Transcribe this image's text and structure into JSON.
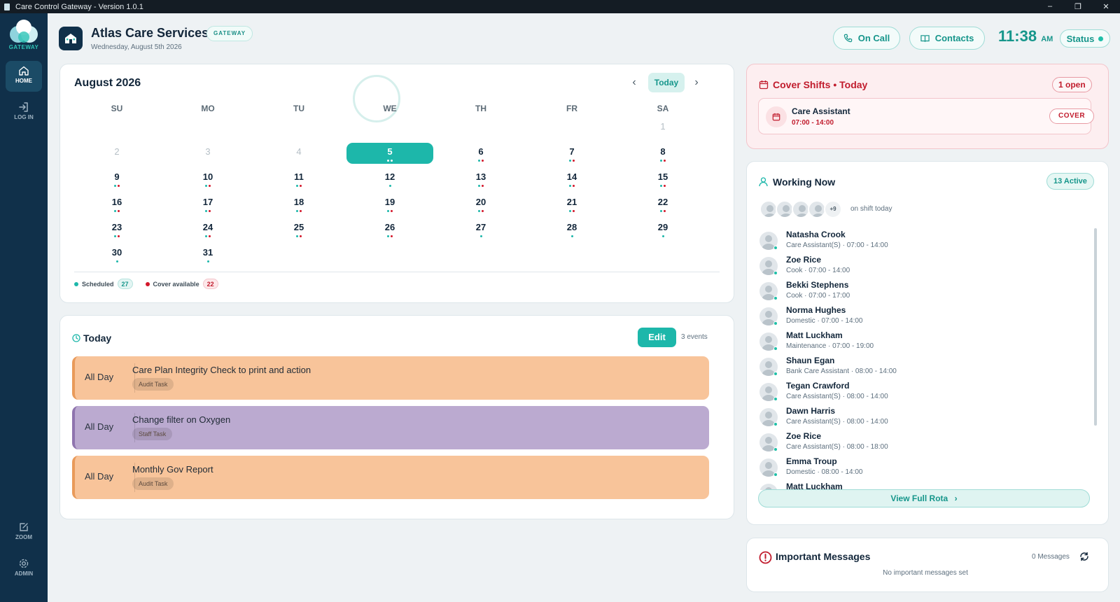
{
  "window": {
    "title": "Care Control Gateway - Version 1.0.1",
    "controls": [
      "–",
      "❐",
      "✕"
    ]
  },
  "sidebar": {
    "logo_text": "GATEWAY",
    "items": [
      {
        "label": "HOME",
        "icon": "home-icon"
      },
      {
        "label": "LOG IN",
        "icon": "login-icon"
      },
      {
        "label": "ZOOM",
        "icon": "zoom-icon"
      },
      {
        "label": "ADMIN",
        "icon": "gear-icon"
      }
    ]
  },
  "header": {
    "title": "Atlas Care Services",
    "tag": "GATEWAY",
    "date": "Wednesday, August 5th 2026",
    "on_call_label": "On Call",
    "contacts_label": "Contacts",
    "time": "11:38",
    "ampm": "AM",
    "status_label": "Status"
  },
  "calendar": {
    "month_title": "August 2026",
    "today_label": "Today",
    "prev_icon": "‹",
    "next_icon": "›",
    "weekdays": [
      "SU",
      "MO",
      "TU",
      "WE",
      "TH",
      "FR",
      "SA"
    ],
    "days": [
      {
        "n": "1",
        "muted": true,
        "dots": []
      },
      {
        "n": "2",
        "muted": true,
        "dots": []
      },
      {
        "n": "3",
        "muted": true,
        "dots": []
      },
      {
        "n": "4",
        "muted": true,
        "dots": []
      },
      {
        "n": "5",
        "selected": true,
        "dots": [
          "g",
          "g"
        ]
      },
      {
        "n": "6",
        "dots": [
          "g",
          "r"
        ]
      },
      {
        "n": "7",
        "dots": [
          "g",
          "r"
        ]
      },
      {
        "n": "8",
        "dots": [
          "g",
          "r"
        ]
      },
      {
        "n": "9",
        "dots": [
          "g",
          "r"
        ]
      },
      {
        "n": "10",
        "dots": [
          "g",
          "r"
        ]
      },
      {
        "n": "11",
        "dots": [
          "g",
          "r"
        ]
      },
      {
        "n": "12",
        "dots": [
          "g"
        ]
      },
      {
        "n": "13",
        "dots": [
          "g",
          "r"
        ]
      },
      {
        "n": "14",
        "dots": [
          "g",
          "r"
        ]
      },
      {
        "n": "15",
        "dots": [
          "g",
          "r"
        ]
      },
      {
        "n": "16",
        "dots": [
          "g",
          "r"
        ]
      },
      {
        "n": "17",
        "dots": [
          "g",
          "r"
        ]
      },
      {
        "n": "18",
        "dots": [
          "g",
          "r"
        ]
      },
      {
        "n": "19",
        "dots": [
          "g",
          "r"
        ]
      },
      {
        "n": "20",
        "dots": [
          "g",
          "r"
        ]
      },
      {
        "n": "21",
        "dots": [
          "g",
          "r"
        ]
      },
      {
        "n": "22",
        "dots": [
          "g",
          "r"
        ]
      },
      {
        "n": "23",
        "dots": [
          "g",
          "r"
        ]
      },
      {
        "n": "24",
        "dots": [
          "g",
          "r"
        ]
      },
      {
        "n": "25",
        "dots": [
          "g",
          "r"
        ]
      },
      {
        "n": "26",
        "dots": [
          "g",
          "r"
        ]
      },
      {
        "n": "27",
        "dots": [
          "g"
        ]
      },
      {
        "n": "28",
        "dots": [
          "g"
        ]
      },
      {
        "n": "29",
        "dots": [
          "g"
        ]
      },
      {
        "n": "30",
        "dots": [
          "g"
        ]
      },
      {
        "n": "31",
        "dots": [
          "g"
        ]
      }
    ],
    "legend": {
      "scheduled_label": "Scheduled",
      "scheduled_count": "27",
      "cover_label": "Cover available",
      "cover_count": "22"
    }
  },
  "today": {
    "title": "Today",
    "edit_label": "Edit",
    "events_count": "3 events",
    "events": [
      {
        "when": "All Day",
        "title": "Care Plan Integrity Check to print and action",
        "tag": "Audit Task",
        "color": "#f8c49a",
        "accent": "#e99a5a"
      },
      {
        "when": "All Day",
        "title": "Change filter on Oxygen",
        "tag": "Staff Task",
        "color": "#bbaad0",
        "accent": "#8f74ae"
      },
      {
        "when": "All Day",
        "title": "Monthly Gov Report",
        "tag": "Audit Task",
        "color": "#f8c49a",
        "accent": "#e99a5a"
      }
    ]
  },
  "cover": {
    "title": "Cover Shifts • Today",
    "open_badge": "1 open",
    "role": "Care Assistant",
    "time": "07:00 - 14:00",
    "badge": "COVER"
  },
  "working": {
    "title": "Working Now",
    "active_badge": "13 Active",
    "more_count": "+9",
    "on_shift_text": "on shift today",
    "staff": [
      {
        "name": "Natasha Crook",
        "detail": "Care Assistant(S) · 07:00 - 14:00"
      },
      {
        "name": "Zoe Rice",
        "detail": "Cook · 07:00 - 14:00"
      },
      {
        "name": "Bekki Stephens",
        "detail": "Cook · 07:00 - 17:00"
      },
      {
        "name": "Norma Hughes",
        "detail": "Domestic · 07:00 - 14:00"
      },
      {
        "name": "Matt Luckham",
        "detail": "Maintenance · 07:00 - 19:00"
      },
      {
        "name": "Shaun Egan",
        "detail": "Bank Care Assistant · 08:00 - 14:00"
      },
      {
        "name": "Tegan Crawford",
        "detail": "Care Assistant(S) · 08:00 - 14:00"
      },
      {
        "name": "Dawn Harris",
        "detail": "Care Assistant(S) · 08:00 - 14:00"
      },
      {
        "name": "Zoe Rice",
        "detail": "Care Assistant(S) · 08:00 - 18:00"
      },
      {
        "name": "Emma Troup",
        "detail": "Domestic · 08:00 - 14:00"
      },
      {
        "name": "Matt Luckham",
        "detail": ""
      }
    ],
    "view_rota_label": "View Full Rota"
  },
  "messages": {
    "title": "Important Messages",
    "count": "0 Messages",
    "empty": "No important messages set"
  },
  "colors": {
    "accent": "#1db7aa",
    "sidebar": "#10304a",
    "cover_red": "#c11c2d"
  }
}
